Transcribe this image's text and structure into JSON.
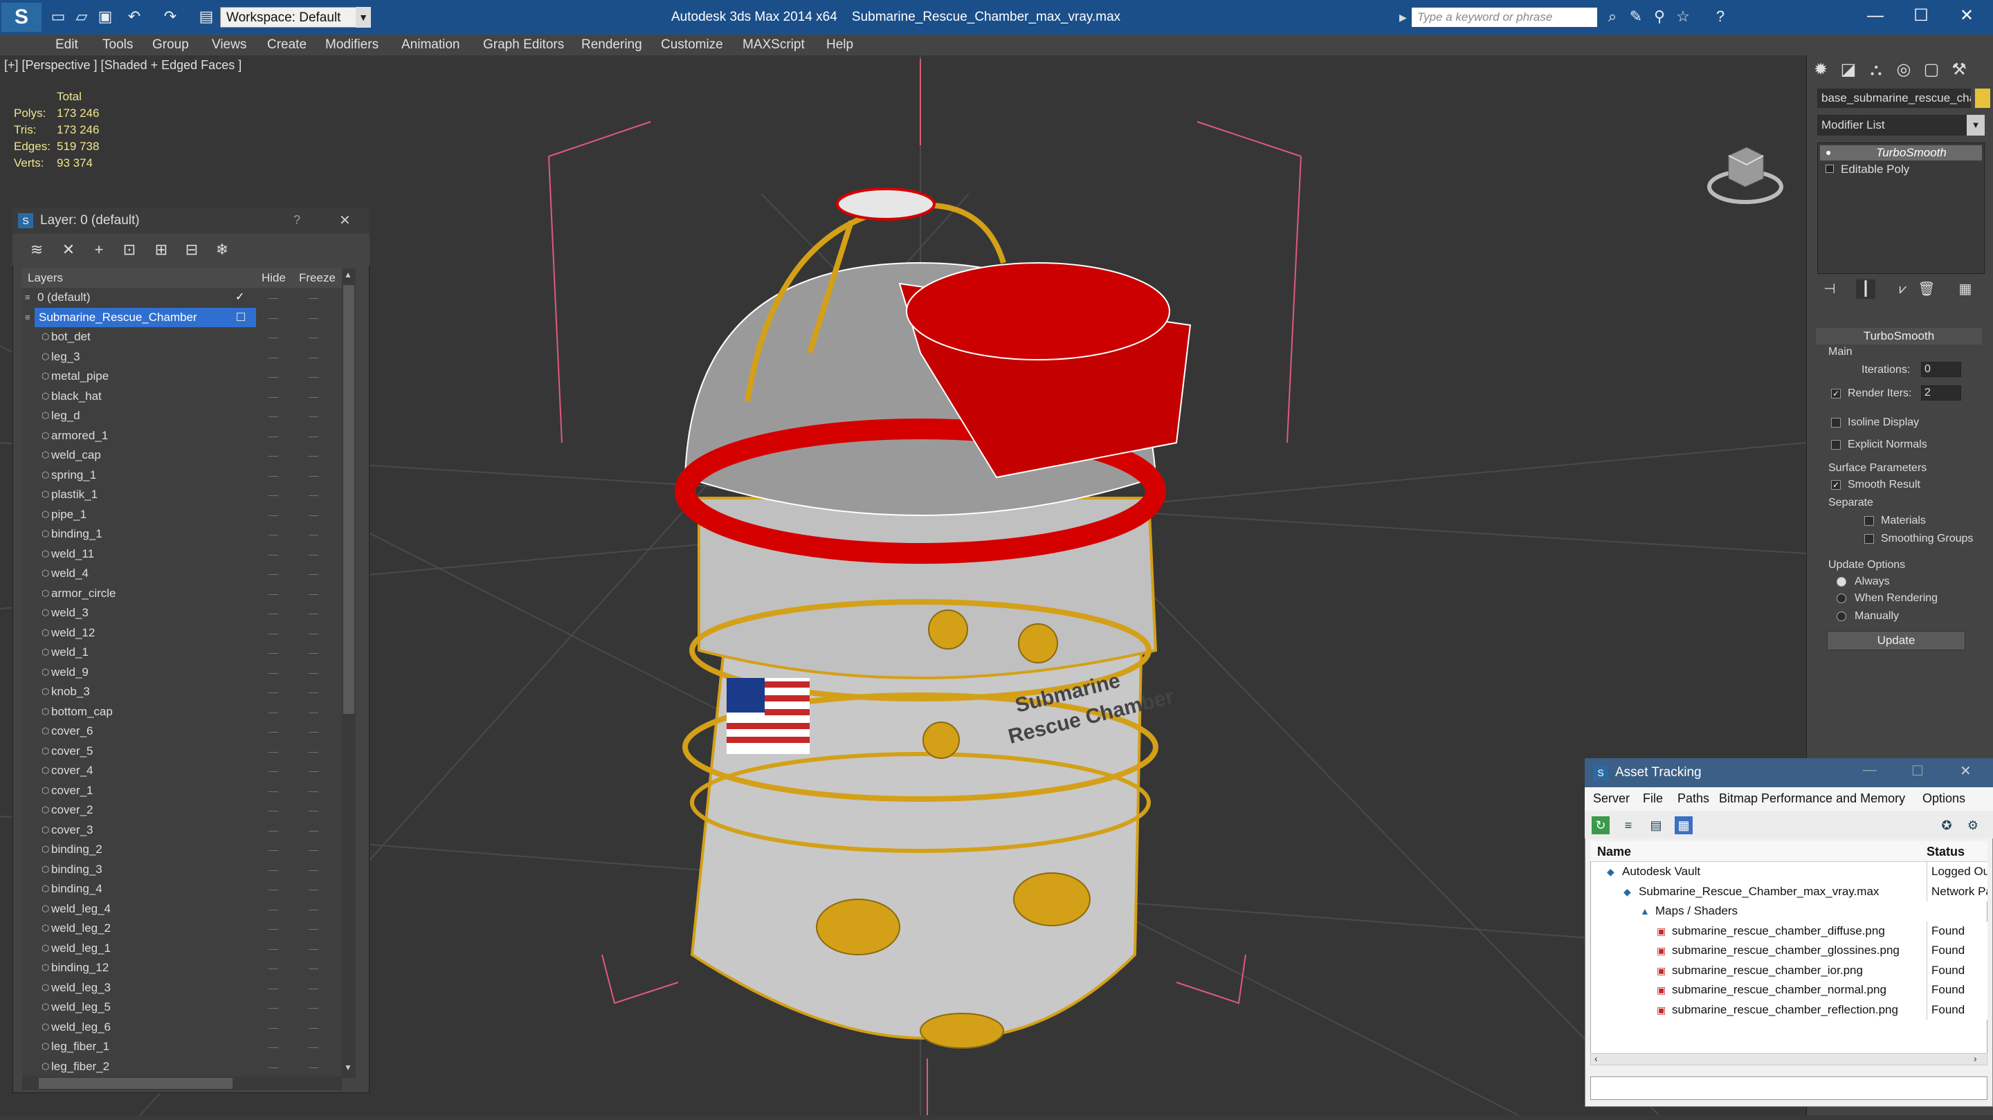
{
  "titlebar": {
    "workspace": "Workspace: Default",
    "app": "Autodesk 3ds Max  2014 x64",
    "file": "Submarine_Rescue_Chamber_max_vray.max",
    "search_placeholder": "Type a keyword or phrase",
    "minimize": "—",
    "maximize": "☐",
    "close": "✕"
  },
  "menu": [
    "Edit",
    "Tools",
    "Group",
    "Views",
    "Create",
    "Modifiers",
    "Animation",
    "Graph Editors",
    "Rendering",
    "Customize",
    "MAXScript",
    "Help"
  ],
  "viewport": {
    "label": "[+] [Perspective ] [Shaded + Edged Faces ]",
    "stats_header": "Total",
    "stats": [
      {
        "label": "Polys:",
        "value": "173 246"
      },
      {
        "label": "Tris:",
        "value": "173 246"
      },
      {
        "label": "Edges:",
        "value": "519 738"
      },
      {
        "label": "Verts:",
        "value": "93 374"
      }
    ],
    "badge_labels": [
      "Submarine",
      "Rescue Chamber"
    ]
  },
  "layer_panel": {
    "title": "Layer: 0 (default)",
    "help": "?",
    "close": "✕",
    "col_layers": "Layers",
    "col_hide": "Hide",
    "col_freeze": "Freeze",
    "rows": [
      {
        "name": "0 (default)",
        "level": 0,
        "selected": false
      },
      {
        "name": "Submarine_Rescue_Chamber",
        "level": 0,
        "selected": true
      },
      {
        "name": "bot_det",
        "level": 1
      },
      {
        "name": "leg_3",
        "level": 1
      },
      {
        "name": "metal_pipe",
        "level": 1
      },
      {
        "name": "black_hat",
        "level": 1
      },
      {
        "name": "leg_d",
        "level": 1
      },
      {
        "name": "armored_1",
        "level": 1
      },
      {
        "name": "weld_cap",
        "level": 1
      },
      {
        "name": "spring_1",
        "level": 1
      },
      {
        "name": "plastik_1",
        "level": 1
      },
      {
        "name": "pipe_1",
        "level": 1
      },
      {
        "name": "binding_1",
        "level": 1
      },
      {
        "name": "weld_11",
        "level": 1
      },
      {
        "name": "weld_4",
        "level": 1
      },
      {
        "name": "armor_circle",
        "level": 1
      },
      {
        "name": "weld_3",
        "level": 1
      },
      {
        "name": "weld_12",
        "level": 1
      },
      {
        "name": "weld_1",
        "level": 1
      },
      {
        "name": "weld_9",
        "level": 1
      },
      {
        "name": "knob_3",
        "level": 1
      },
      {
        "name": "bottom_cap",
        "level": 1
      },
      {
        "name": "cover_6",
        "level": 1
      },
      {
        "name": "cover_5",
        "level": 1
      },
      {
        "name": "cover_4",
        "level": 1
      },
      {
        "name": "cover_1",
        "level": 1
      },
      {
        "name": "cover_2",
        "level": 1
      },
      {
        "name": "cover_3",
        "level": 1
      },
      {
        "name": "binding_2",
        "level": 1
      },
      {
        "name": "binding_3",
        "level": 1
      },
      {
        "name": "binding_4",
        "level": 1
      },
      {
        "name": "weld_leg_4",
        "level": 1
      },
      {
        "name": "weld_leg_2",
        "level": 1
      },
      {
        "name": "weld_leg_1",
        "level": 1
      },
      {
        "name": "binding_12",
        "level": 1
      },
      {
        "name": "weld_leg_3",
        "level": 1
      },
      {
        "name": "weld_leg_5",
        "level": 1
      },
      {
        "name": "weld_leg_6",
        "level": 1
      },
      {
        "name": "leg_fiber_1",
        "level": 1
      },
      {
        "name": "leg_fiber_2",
        "level": 1
      }
    ]
  },
  "command_panel": {
    "object_name": "base_submarine_rescue_cha",
    "object_color": "#e8c23a",
    "modifier_list": "Modifier List",
    "stack": [
      "TurboSmooth",
      "Editable Poly"
    ],
    "rollout_title": "TurboSmooth",
    "main": "Main",
    "iterations_label": "Iterations:",
    "iterations": "0",
    "render_iters_label": "Render Iters:",
    "render_iters": "2",
    "isoline": "Isoline Display",
    "explicit": "Explicit Normals",
    "surface_params": "Surface Parameters",
    "smooth_result": "Smooth Result",
    "separate": "Separate",
    "materials": "Materials",
    "smoothing_groups": "Smoothing Groups",
    "update_options": "Update Options",
    "always": "Always",
    "when_rendering": "When Rendering",
    "manually": "Manually",
    "update": "Update"
  },
  "asset_tracking": {
    "title": "Asset Tracking",
    "menu": [
      "Server",
      "File",
      "Paths",
      "Bitmap Performance and Memory",
      "Options"
    ],
    "col_name": "Name",
    "col_status": "Status",
    "rows": [
      {
        "name": "Autodesk Vault",
        "status": "Logged Ou",
        "indent": 0
      },
      {
        "name": "Submarine_Rescue_Chamber_max_vray.max",
        "status": "Network Pa",
        "indent": 1
      },
      {
        "name": "Maps / Shaders",
        "status": "",
        "indent": 2
      },
      {
        "name": "submarine_rescue_chamber_diffuse.png",
        "status": "Found",
        "indent": 3
      },
      {
        "name": "submarine_rescue_chamber_glossines.png",
        "status": "Found",
        "indent": 3
      },
      {
        "name": "submarine_rescue_chamber_ior.png",
        "status": "Found",
        "indent": 3
      },
      {
        "name": "submarine_rescue_chamber_normal.png",
        "status": "Found",
        "indent": 3
      },
      {
        "name": "submarine_rescue_chamber_reflection.png",
        "status": "Found",
        "indent": 3
      }
    ]
  }
}
